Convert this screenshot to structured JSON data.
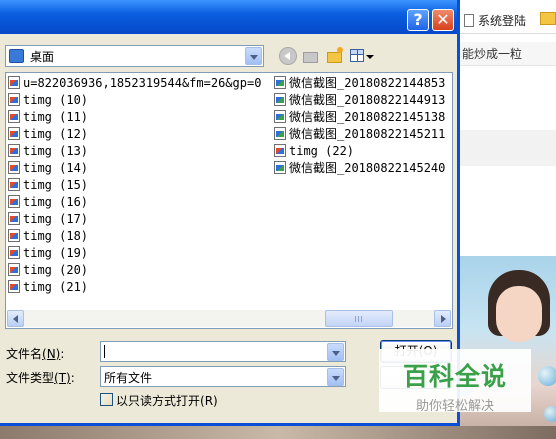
{
  "background": {
    "tab_label": "系统登陆",
    "article_snippet": "能炒成一粒"
  },
  "watermark": {
    "main": "百科全说",
    "sub": "助你轻松解决"
  },
  "dialog": {
    "help_button": "?",
    "close_button": "✕",
    "look_in": {
      "value": "桌面"
    },
    "files": {
      "column1": [
        "u=822036936,1852319544&fm=26&gp=0",
        "timg (10)",
        "timg (11)",
        "timg (12)",
        "timg (13)",
        "timg (14)",
        "timg (15)",
        "timg (16)",
        "timg (17)",
        "timg (18)",
        "timg (19)",
        "timg (20)",
        "timg (21)"
      ],
      "column2": [
        "微信截图_20180822144853",
        "微信截图_20180822144913",
        "微信截图_20180822145138",
        "微信截图_20180822145211",
        "timg (22)",
        "微信截图_20180822145240"
      ]
    },
    "file_name": {
      "label_text": "文件名",
      "label_hotkey": "(N)",
      "label_colon": ":",
      "value": ""
    },
    "file_type": {
      "label_text": "文件类型",
      "label_hotkey": "(T)",
      "label_colon": ":",
      "value": "所有文件"
    },
    "readonly_checkbox": {
      "label": "以只读方式打开",
      "hotkey": "(R)",
      "checked": false
    },
    "open_button": "打开(O)",
    "cancel_button": ""
  }
}
